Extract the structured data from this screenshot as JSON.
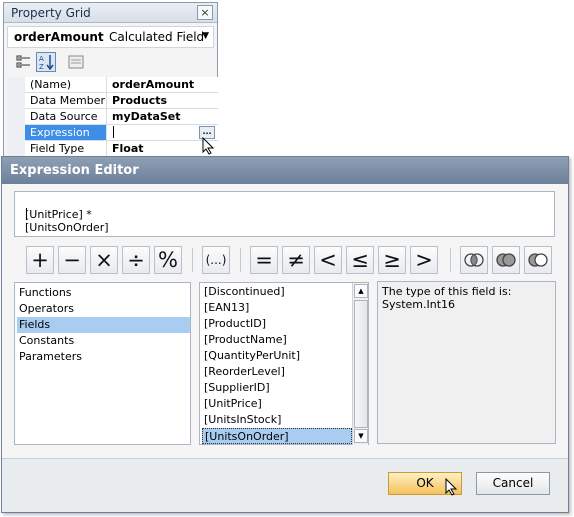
{
  "property_grid": {
    "title": "Property Grid",
    "close_glyph": "×",
    "selected_component": "orderAmount",
    "selected_type": "Calculated Field",
    "rows": [
      {
        "name": "(Name)",
        "value": "orderAmount"
      },
      {
        "name": "Data Member",
        "value": "Products"
      },
      {
        "name": "Data Source",
        "value": "myDataSet"
      },
      {
        "name": "Expression",
        "value": ""
      },
      {
        "name": "Field Type",
        "value": "Float"
      }
    ],
    "ellipsis": "..."
  },
  "expression_editor": {
    "title": "Expression Editor",
    "expression": "[UnitPrice] * [UnitsOnOrder]",
    "operators": [
      "+",
      "−",
      "×",
      "÷",
      "%",
      "(...)",
      "=",
      "≠",
      "<",
      "≤",
      "≥",
      ">"
    ],
    "categories": [
      "Functions",
      "Operators",
      "Fields",
      "Constants",
      "Parameters"
    ],
    "selected_category": "Fields",
    "fields": [
      "[Discontinued]",
      "[EAN13]",
      "[ProductID]",
      "[ProductName]",
      "[QuantityPerUnit]",
      "[ReorderLevel]",
      "[SupplierID]",
      "[UnitPrice]",
      "[UnitsInStock]",
      "[UnitsOnOrder]"
    ],
    "selected_field": "[UnitsOnOrder]",
    "description_line1": "The type of this field is:",
    "description_line2": "System.Int16",
    "ok_label": "OK",
    "cancel_label": "Cancel"
  },
  "icons": [
    "close-icon",
    "chevron-down-icon",
    "categorized-icon",
    "alphabetical-icon",
    "property-pages-icon",
    "ellipsis-icon",
    "and-icon",
    "or-icon",
    "not-icon",
    "scroll-up-icon",
    "scroll-down-icon",
    "mouse-cursor-icon"
  ]
}
